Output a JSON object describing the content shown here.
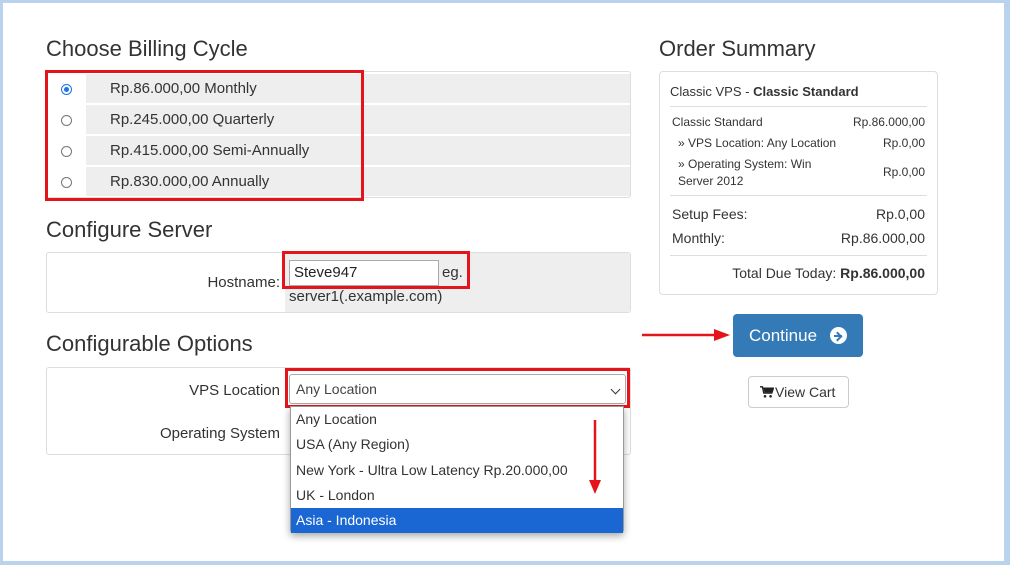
{
  "billing": {
    "heading": "Choose Billing Cycle",
    "options": [
      {
        "label": "Rp.86.000,00 Monthly",
        "checked": true
      },
      {
        "label": "Rp.245.000,00 Quarterly",
        "checked": false
      },
      {
        "label": "Rp.415.000,00 Semi-Annually",
        "checked": false
      },
      {
        "label": "Rp.830.000,00 Annually",
        "checked": false
      }
    ]
  },
  "server": {
    "heading": "Configure Server",
    "hostname_label": "Hostname:",
    "hostname_value": "Steve947",
    "hostname_hint_a": "eg.",
    "hostname_hint_b": "server1(.example.com)"
  },
  "options": {
    "heading": "Configurable Options",
    "vps_location_label": "VPS Location",
    "vps_location_value": "Any Location",
    "os_label": "Operating System",
    "dropdown_items": [
      {
        "label": "Any Location",
        "selected": false
      },
      {
        "label": "USA (Any Region)",
        "selected": false
      },
      {
        "label": "New York - Ultra Low Latency Rp.20.000,00",
        "selected": false
      },
      {
        "label": "UK - London",
        "selected": false
      },
      {
        "label": "Asia - Indonesia",
        "selected": true
      }
    ]
  },
  "summary": {
    "heading": "Order Summary",
    "product_group": "Classic VPS - ",
    "product_name": "Classic Standard",
    "lines": [
      {
        "name": "Classic Standard",
        "price": "Rp.86.000,00"
      },
      {
        "name": "» VPS Location: Any Location",
        "price": "Rp.0,00"
      },
      {
        "name": "» Operating System: Win Server 2012",
        "price": "Rp.0,00"
      }
    ],
    "setup_fees_label": "Setup Fees:",
    "setup_fees_value": "Rp.0,00",
    "monthly_label": "Monthly:",
    "monthly_value": "Rp.86.000,00",
    "total_label": "Total Due Today:",
    "total_value": "Rp.86.000,00"
  },
  "actions": {
    "continue_label": "Continue",
    "view_cart_label": "View Cart"
  },
  "colors": {
    "accent": "#337ab7",
    "highlight_red": "#e3141b",
    "selected_item": "#1a66d2"
  }
}
